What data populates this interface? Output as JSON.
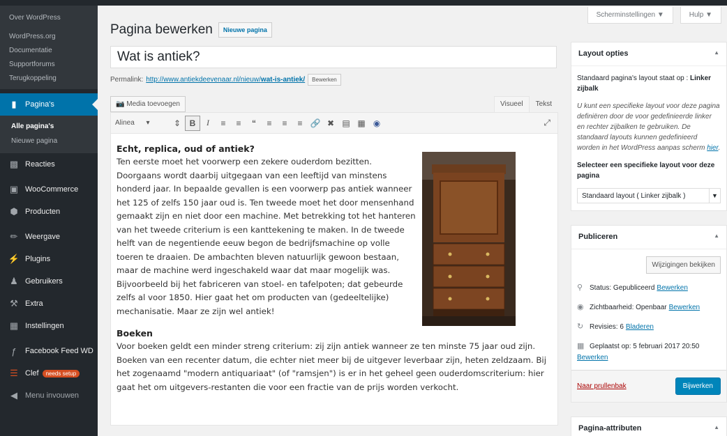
{
  "sidebar": {
    "top_links": [
      "Over WordPress",
      "WordPress.org",
      "Documentatie",
      "Supportforums",
      "Terugkoppeling"
    ],
    "pages_label": "Pagina's",
    "pages_sub": [
      "Alle pagina's",
      "Nieuwe pagina"
    ],
    "items": [
      "Reacties",
      "WooCommerce",
      "Producten",
      "Weergave",
      "Plugins",
      "Gebruikers",
      "Extra",
      "Instellingen",
      "Facebook Feed WD",
      "Clef",
      "Menu invouwen"
    ],
    "clef_badge": "needs setup"
  },
  "screen_meta": {
    "screen_options": "Scherminstellingen ▼",
    "help": "Hulp ▼"
  },
  "main": {
    "page_title": "Pagina bewerken",
    "add_new": "Nieuwe pagina",
    "post_title": "Wat is antiek?",
    "permalink_label": "Permalink:",
    "permalink_base": "http://www.antiekdeevenaar.nl/nieuw/",
    "permalink_slug": "wat-is-antiek/",
    "edit_button": "Bewerken",
    "media_button": "Media toevoegen",
    "tab_visual": "Visueel",
    "tab_text": "Tekst",
    "format_select": "Alinea"
  },
  "content": {
    "h1": "Echt, replica, oud of antiek?",
    "p1": "Ten eerste moet het voorwerp een zekere ouderdom bezitten. Doorgaans wordt daarbij uitgegaan van een leeftijd van minstens honderd jaar. In bepaalde gevallen is een voorwerp pas antiek wanneer het 125 of zelfs 150 jaar oud is. Ten tweede moet het door mensenhand gemaakt zijn en niet door een machine. Met betrekking tot het hanteren van het tweede criterium is een kanttekening te maken. In de tweede helft van de negentiende eeuw begon de bedrijfsmachine op volle toeren te draaien. De ambachten bleven natuurlijk gewoon bestaan, maar de machine werd ingeschakeld waar dat maar mogelijk was. Bijvoorbeeld bij het fabriceren van stoel- en tafelpoten; dat gebeurde zelfs al voor 1850. Hier gaat het om producten van (gedeeltelijke) mechanisatie. Maar ze zijn wel antiek!",
    "h2": "Boeken",
    "p2": "Voor boeken geldt een minder streng criterium: zij zijn antiek wanneer ze ten minste 75 jaar oud zijn. Boeken van een recenter datum, die echter niet meer bij de uitgever leverbaar zijn, heten zeldzaam. Bij het zogenaamd \"modern antiquariaat\" (of \"ramsjen\") is er in het geheel geen ouderdomscriterium: hier gaat het om uitgevers-restanten die voor een fractie van de prijs worden verkocht."
  },
  "layout_box": {
    "title": "Layout opties",
    "default_text": "Standaard pagina's layout staat op :",
    "default_value": "Linker zijbalk",
    "info": "U kunt een specifieke layout voor deze pagina definiëren door de voor gedefinieerde linker en rechter zijbalken te gebruiken. De standaard layouts kunnen gedefinieerd worden in het WordPress aanpas scherm",
    "info_link": "hier",
    "select_label": "Selecteer een specifieke layout voor deze pagina",
    "select_value": "Standaard layout ( Linker zijbalk )"
  },
  "publish_box": {
    "title": "Publiceren",
    "preview": "Wijzigingen bekijken",
    "status_label": "Status:",
    "status_value": "Gepubliceerd",
    "visibility_label": "Zichtbaarheid:",
    "visibility_value": "Openbaar",
    "revisions_label": "Revisies: 6",
    "revisions_link": "Bladeren",
    "published_label": "Geplaatst op:",
    "published_value": "5 februari 2017 20:50",
    "edit_link": "Bewerken",
    "trash": "Naar prullenbak",
    "update": "Bijwerken"
  },
  "attributes_box": {
    "title": "Pagina-attributen"
  }
}
